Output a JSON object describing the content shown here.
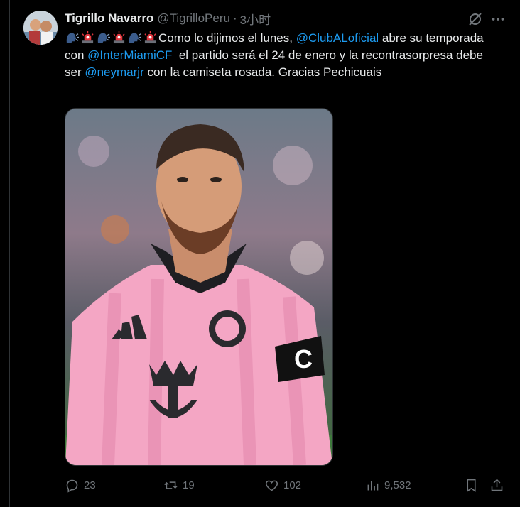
{
  "tweet": {
    "display_name": "Tigrillo Navarro",
    "handle": "@TigrilloPeru",
    "separator": "·",
    "time": "3小时",
    "text_parts": [
      {
        "text": "Como lo dijimos el lunes, ",
        "link": false
      },
      {
        "text": "@ClubALoficial",
        "link": true
      },
      {
        "text": " abre su temporada con ",
        "link": false
      },
      {
        "text": "@InterMiamiCF",
        "link": true
      },
      {
        "text": "  el partido será el 24 de enero y la recontrasorpresa debe ser ",
        "link": false
      },
      {
        "text": "@neymarjr",
        "link": true
      },
      {
        "text": " con la camiseta rosada. Gracias Pechicuais",
        "link": false
      }
    ],
    "leading_emojis": [
      "speaking-head-icon",
      "police-light-icon",
      "speaking-head-icon",
      "police-light-icon",
      "speaking-head-icon",
      "police-light-icon"
    ]
  },
  "actions": {
    "replies": "23",
    "reposts": "19",
    "likes": "102",
    "views": "9,532"
  },
  "colors": {
    "background": "#000000",
    "text": "#e7e9ea",
    "muted": "#71767b",
    "link": "#1d9bf0",
    "jersey_pink": "#f4a6c4"
  }
}
